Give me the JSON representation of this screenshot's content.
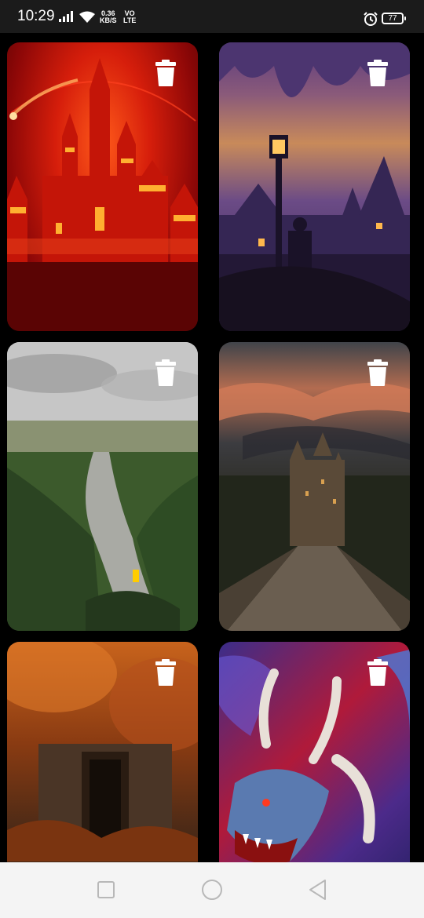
{
  "status_bar": {
    "time": "10:29",
    "net_speed_value": "0.36",
    "net_speed_unit": "KB/S",
    "volte_top": "VO",
    "volte_bottom": "LTE",
    "battery_level": "77"
  },
  "wallpapers": [
    {
      "scene": "castle-night-red",
      "accent": "#d61e0b"
    },
    {
      "scene": "lamp-post-city-purple",
      "accent": "#6b4b86"
    },
    {
      "scene": "canyon-river-hiker",
      "accent": "#4a6d3a"
    },
    {
      "scene": "castle-stone-bridge-sunset",
      "accent": "#b36c50"
    },
    {
      "scene": "forest-ruin-doorway-autumn",
      "accent": "#8a3b12"
    },
    {
      "scene": "blue-dragon-horns",
      "accent": "#b01a3a"
    }
  ],
  "icons": {
    "delete": "trash-icon",
    "nav_recent": "square-icon",
    "nav_home": "circle-icon",
    "nav_back": "triangle-back-icon"
  }
}
